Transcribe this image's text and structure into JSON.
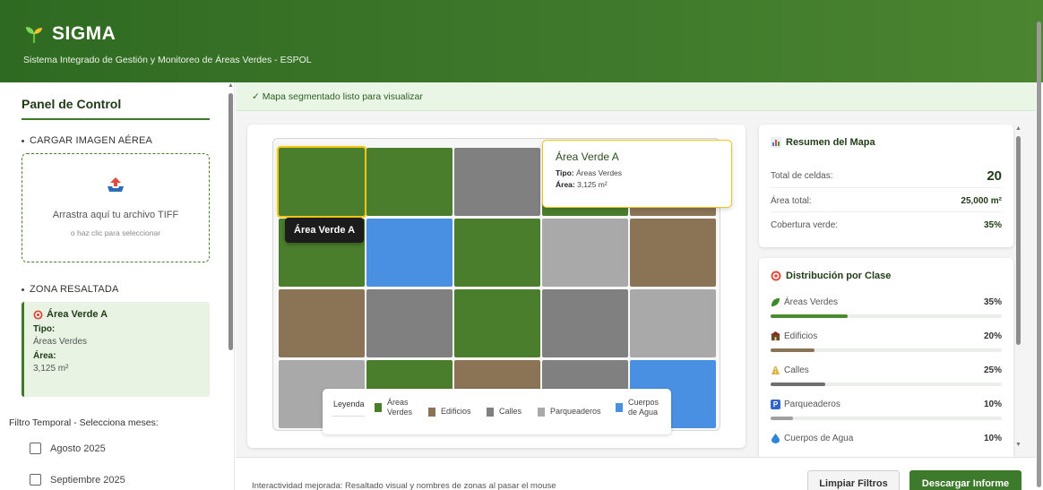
{
  "header": {
    "title": "SIGMA",
    "subtitle": "Sistema Integrado de Gestión y Monitoreo de Áreas Verdes - ESPOL",
    "logo_icon": "sprout-icon",
    "bg_color": "#3b7529"
  },
  "sidebar": {
    "title": "Panel de Control",
    "upload_section": "CARGAR IMAGEN AÉREA",
    "upload_main": "Arrastra aquí tu archivo TIFF",
    "upload_sub": "o haz clic para seleccionar",
    "zone_section": "ZONA RESALTADA",
    "zone": {
      "name": "Área Verde A",
      "type_label": "Tipo:",
      "type_value": "Áreas Verdes",
      "area_label": "Área:",
      "area_value": "3,125 m²"
    },
    "filter_label": "Filtro Temporal - Selecciona meses:",
    "months": [
      {
        "label": "Agosto 2025",
        "checked": false
      },
      {
        "label": "Septiembre 2025",
        "checked": false
      }
    ]
  },
  "status": {
    "text": "✓ Mapa segmentado listo para visualizar"
  },
  "map": {
    "rows": [
      [
        "green",
        "green",
        "gray",
        "green",
        "brown"
      ],
      [
        "green",
        "blue",
        "green",
        "lgray",
        "brown"
      ],
      [
        "brown",
        "gray",
        "green",
        "gray",
        "lgray"
      ],
      [
        "lgray",
        "green",
        "brown",
        "gray",
        "blue"
      ]
    ],
    "colors": {
      "green": "#4a7e2c",
      "brown": "#8b7355",
      "gray": "#808080",
      "lgray": "#a9a9a9",
      "blue": "#4a90e2"
    },
    "hover_label": "Área Verde A",
    "popup": {
      "title": "Área Verde A",
      "type_label": "Tipo:",
      "type_value": "Áreas Verdes",
      "area_label": "Área:",
      "area_value": "3,125 m²"
    },
    "legend": {
      "title": "Leyenda",
      "items": [
        {
          "label": "Áreas Verdes",
          "color": "#4a7e2c"
        },
        {
          "label": "Edificios",
          "color": "#8b7355"
        },
        {
          "label": "Calles",
          "color": "#808080"
        },
        {
          "label": "Parqueaderos",
          "color": "#a9a9a9"
        },
        {
          "label": "Cuerpos de Agua",
          "color": "#4a90e2"
        }
      ]
    }
  },
  "summary": {
    "title": "Resumen del Mapa",
    "rows": [
      {
        "label": "Total de celdas:",
        "value": "20"
      },
      {
        "label": "Área total:",
        "value": "25,000 m²"
      },
      {
        "label": "Cobertura verde:",
        "value": "35%"
      }
    ]
  },
  "distribution": {
    "title": "Distribución por Clase",
    "items": [
      {
        "label": "Áreas Verdes",
        "pct": "35%",
        "fraction": 0.35,
        "color": "#4c8a32",
        "icon": "leaf-icon"
      },
      {
        "label": "Edificios",
        "pct": "20%",
        "fraction": 0.2,
        "color": "#8b7355",
        "icon": "building-icon"
      },
      {
        "label": "Calles",
        "pct": "25%",
        "fraction": 0.25,
        "color": "#6f6f6f",
        "icon": "road-icon"
      },
      {
        "label": "Parqueaderos",
        "pct": "10%",
        "fraction": 0.1,
        "color": "#a0a0a0",
        "icon": "parking-icon"
      },
      {
        "label": "Cuerpos de Agua",
        "pct": "10%",
        "fraction": 0.1,
        "color": "#4a90e2",
        "icon": "water-drop-icon"
      }
    ]
  },
  "footer": {
    "note": "Interactividad mejorada: Resaltado visual y nombres de zonas al pasar el mouse",
    "clear_label": "Limpiar Filtros",
    "download_label": "Descargar Informe"
  }
}
